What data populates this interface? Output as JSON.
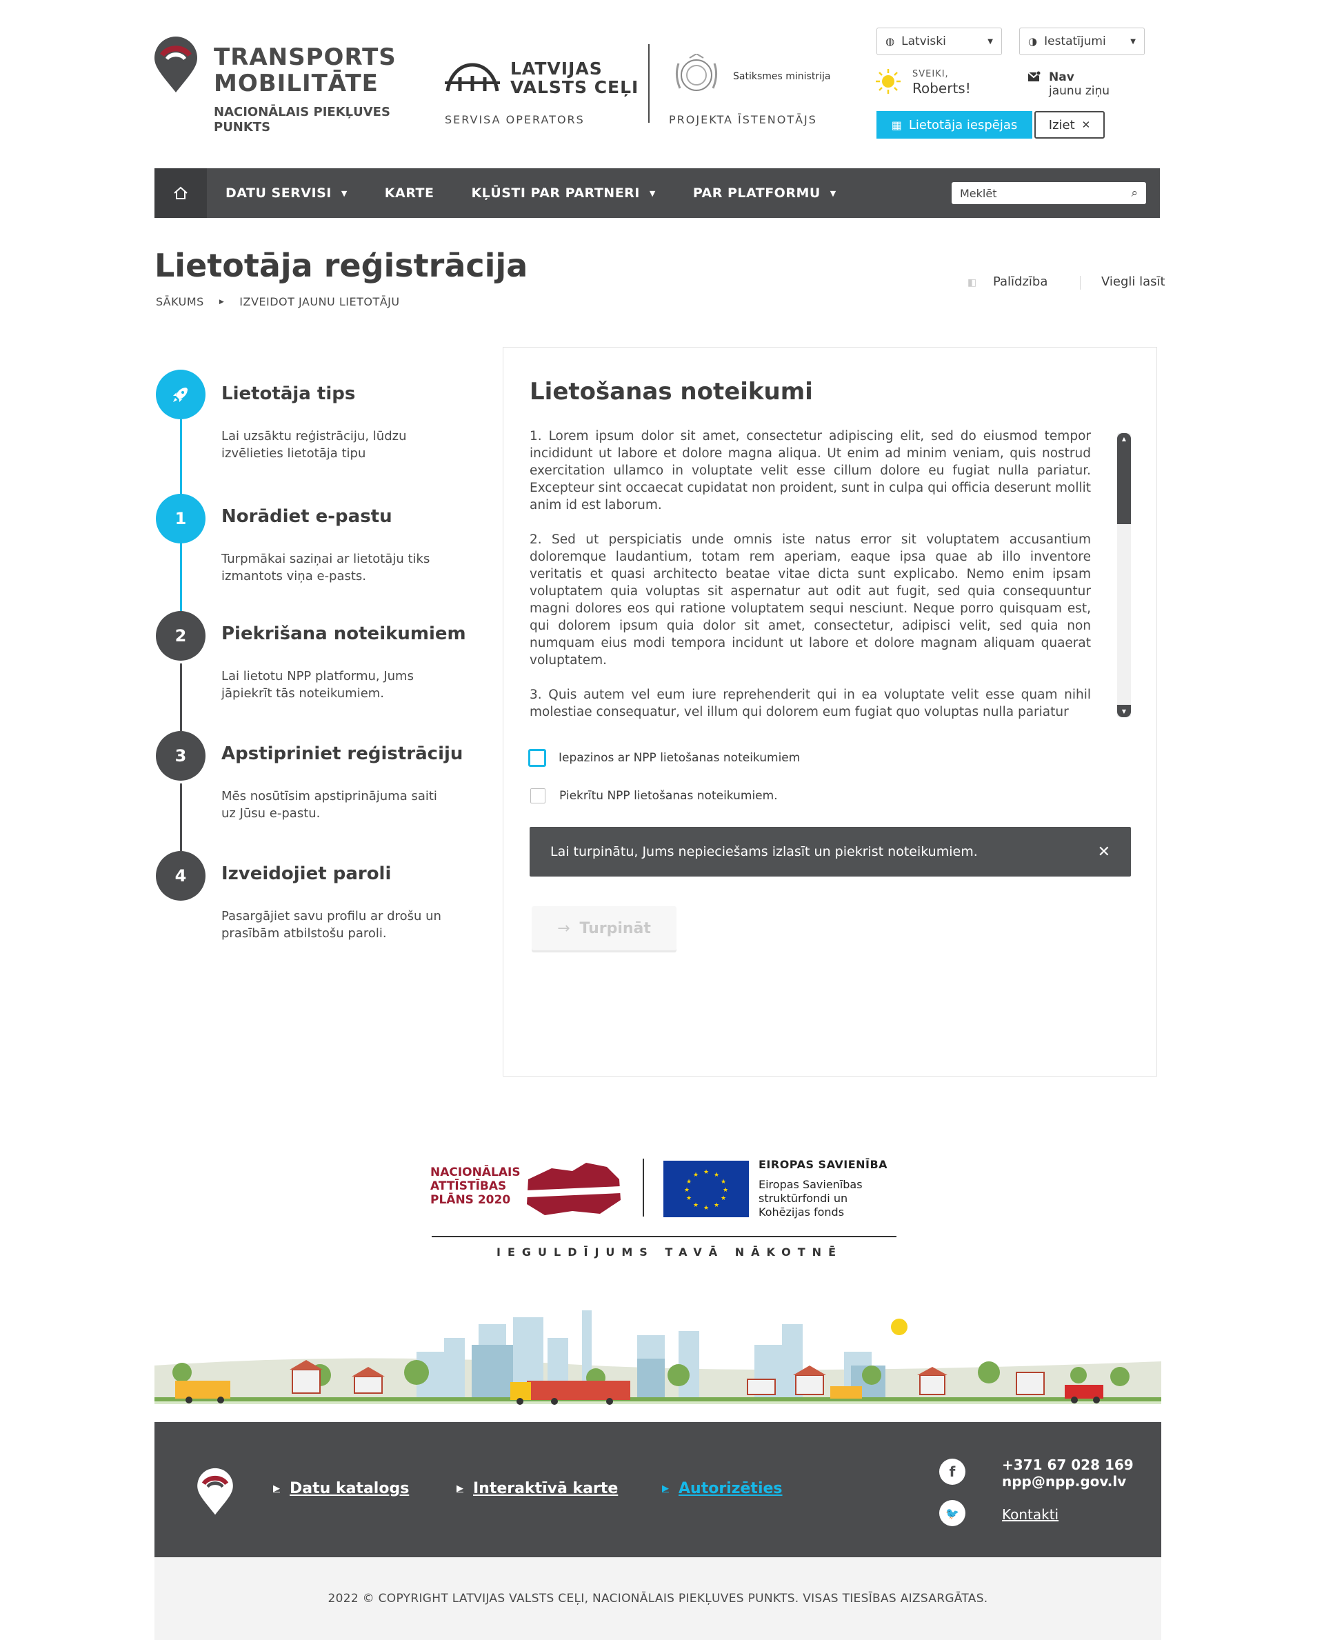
{
  "header": {
    "brand_title_1": "TRANSPORTS",
    "brand_title_2": "MOBILITĀTE",
    "brand_sub_1": "NACIONĀLAIS PIEKĻUVES",
    "brand_sub_2": "PUNKTS",
    "lvc_name_1": "LATVIJAS",
    "lvc_name_2": "VALSTS CEĻI",
    "lvc_role": "SERVISA OPERATORS",
    "ministry_name": "Satiksmes ministrija",
    "ministry_role": "PROJEKTA ĪSTENOTĀJS",
    "language_select": "Latviski",
    "settings_select": "Iestatījumi",
    "greeting_small": "SVEIKI,",
    "greeting_name": "Roberts!",
    "messages_line1": "Nav",
    "messages_line2": "jaunu ziņu",
    "user_options_button": "Lietotāja iespējas",
    "logout_button": "Iziet"
  },
  "nav": {
    "items": [
      "DATU SERVISI",
      "KARTE",
      "KĻŪSTI PAR PARTNERI",
      "PAR PLATFORMU"
    ],
    "search_placeholder": "Meklēt"
  },
  "page": {
    "title": "Lietotāja reģistrācija",
    "breadcrumb": [
      "SĀKUMS",
      "IZVEIDOT JAUNU LIETOTĀJU"
    ],
    "help": "Palīdzība",
    "easy_read": "Viegli lasīt"
  },
  "steps": [
    {
      "badge": "",
      "title": "Lietotāja tips",
      "desc": "Lai uzsāktu reģistrāciju, lūdzu izvēlieties lietotāja tipu"
    },
    {
      "badge": "1",
      "title": "Norādiet e-pastu",
      "desc": "Turpmākai saziņai ar lietotāju tiks izmantots viņa e-pasts."
    },
    {
      "badge": "2",
      "title": "Piekrišana noteikumiem",
      "desc": "Lai lietotu NPP platformu, Jums jāpiekrīt tās noteikumiem."
    },
    {
      "badge": "3",
      "title": "Apstipriniet reģistrāciju",
      "desc": "Mēs nosūtīsim apstiprinājuma saiti uz Jūsu e-pastu."
    },
    {
      "badge": "4",
      "title": "Izveidojiet paroli",
      "desc": "Pasargājiet savu profilu ar drošu un prasībām atbilstošu paroli."
    }
  ],
  "terms": {
    "title": "Lietošanas noteikumi",
    "paragraphs": [
      "1. Lorem ipsum dolor sit amet, consectetur adipiscing elit, sed do eiusmod tempor incididunt ut labore et dolore magna aliqua. Ut enim ad minim veniam, quis nostrud exercitation ullamco in voluptate velit esse cillum dolore eu fugiat nulla pariatur. Excepteur sint occaecat cupidatat non proident, sunt in culpa qui officia deserunt mollit anim id est laborum.",
      "2. Sed ut perspiciatis unde omnis iste natus error sit voluptatem accusantium doloremque laudantium, totam rem aperiam, eaque ipsa quae ab illo inventore veritatis et quasi architecto beatae vitae dicta sunt explicabo. Nemo enim ipsam voluptatem quia voluptas sit aspernatur aut odit aut fugit, sed quia consequuntur magni dolores eos qui ratione voluptatem sequi nesciunt. Neque porro quisquam est, qui dolorem ipsum quia dolor sit amet, consectetur, adipisci velit, sed quia non numquam eius modi tempora incidunt ut labore et dolore magnam aliquam quaerat voluptatem.",
      "3. Quis autem vel eum iure reprehenderit qui in ea voluptate velit esse quam nihil molestiae consequatur, vel illum qui dolorem eum fugiat quo voluptas nulla pariatur"
    ],
    "checkbox_read": "Iepazinos ar NPP lietošanas noteikumiem",
    "checkbox_agree": "Piekrītu NPP lietošanas noteikumiem.",
    "alert": "Lai turpinātu, Jums nepieciešams izlasīt un piekrist noteikumiem.",
    "continue_button": "Turpināt"
  },
  "funding": {
    "nap_1": "NACIONĀLAIS",
    "nap_2": "ATTĪSTĪBAS",
    "nap_3": "PLĀNS 2020",
    "eu_title": "EIROPAS SAVIENĪBA",
    "eu_1": "Eiropas Savienības",
    "eu_2": "struktūrfondi un",
    "eu_3": "Kohēzijas fonds",
    "invest": "IEGULDĪJUMS TAVĀ NĀKOTNĒ"
  },
  "footer": {
    "links": [
      "Datu katalogs",
      "Interaktīvā karte",
      "Autorizēties"
    ],
    "phone": "+371 67 028 169",
    "email": "npp@npp.gov.lv",
    "contacts": "Kontakti",
    "copyright": "2022 © COPYRIGHT LATVIJAS VALSTS CEĻI, NACIONĀLAIS PIEKĻUVES PUNKTS. VISAS TIESĪBAS AIZSARGĀTAS."
  },
  "colors": {
    "accent": "#16b8e8",
    "dark": "#4b4c4e",
    "brand_red": "#9b1c31"
  }
}
